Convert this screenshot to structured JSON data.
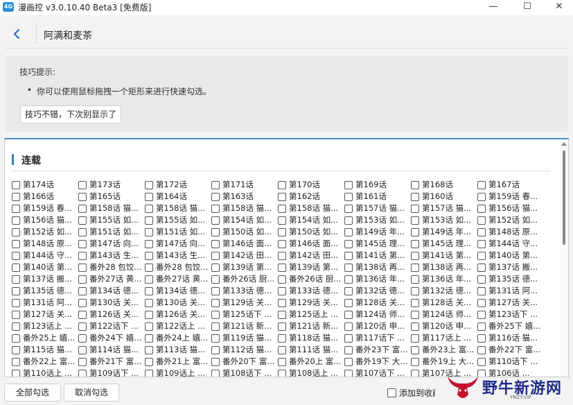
{
  "window": {
    "icon_text": "4G",
    "title": "漫画控 v3.0.10.40 Beta3 [免费版]",
    "minimize_glyph": "—",
    "maximize_glyph": "☐",
    "close_glyph": "✕"
  },
  "header": {
    "title": "阿满和麦茶"
  },
  "tip": {
    "title": "技巧提示:",
    "bullet": "你可以使用鼠标拖拽一个矩形来进行快速勾选。",
    "dismiss_button": "技巧不错，下次别显示了"
  },
  "section": {
    "title": "连载"
  },
  "chapters": [
    "第174话",
    "第173话",
    "第172话",
    "第171话",
    "第170话",
    "第169话",
    "第168话",
    "第167话",
    "第166话",
    "第165话",
    "第164话",
    "第163话",
    "第162话",
    "第161话",
    "第160话",
    "第159话 春...",
    "第159话 春...",
    "第158话 猫...",
    "第158话 猫...",
    "第158话 猫...",
    "第158话 猫...",
    "第157话 猫...",
    "第157话 猫...",
    "第156话 猫...",
    "第156话 猫...",
    "第155话 如...",
    "第155话 如...",
    "第154话 如...",
    "第154话 如...",
    "第153话 如...",
    "第153话 如...",
    "第152话 如...",
    "第152话 如...",
    "第151话 如...",
    "第151话 如...",
    "第150话 如...",
    "第150话 如...",
    "第149话 年...",
    "第149话 年...",
    "第148话 原...",
    "第148话 原...",
    "第147话 向...",
    "第147话 向...",
    "第146话 面...",
    "第146话 面...",
    "第145话 理...",
    "第145话 理...",
    "第144话 守...",
    "第144话 守...",
    "第143话 生...",
    "第143话 生...",
    "第142话 田...",
    "第142话 田...",
    "第141话 第...",
    "第141话 第...",
    "第140话 第...",
    "第140话 第...",
    "番外28 包饺...",
    "番外28 包饺...",
    "第139话 第...",
    "第139话 第...",
    "第138话 再...",
    "第138话 再...",
    "第137话 搬...",
    "第137话 搬...",
    "番外27话 黄...",
    "番外27话 黄...",
    "番外26话 厨...",
    "番外26话 厨...",
    "第136话 年...",
    "第136话 年...",
    "第135话 德...",
    "第135话 德...",
    "第134话 德...",
    "第134话 德...",
    "第133话 德...",
    "第133话 德...",
    "第132话 德...",
    "第132话 德...",
    "第131话 阿...",
    "第131话 阿...",
    "第130话 关...",
    "第130话 关...",
    "第129话 关...",
    "第129话 关...",
    "第128话 关...",
    "第128话 关...",
    "第127话 关...",
    "第127话 关...",
    "第126话 关...",
    "第126话 关...",
    "第125话下 ...",
    "第125话上 ...",
    "第124话 师...",
    "第124话 师...",
    "第123话下 ...",
    "第123话上 ...",
    "第122话下 ...",
    "第122话上 ...",
    "第121话 新...",
    "第121话 新...",
    "第120话 申...",
    "第120话 申...",
    "番外25下 嬉...",
    "番外25上 嬉...",
    "番外24下 嬉...",
    "番外24上 嬉...",
    "第119话 猫...",
    "第118话 猫...",
    "第117话下 ...",
    "第117话上 ...",
    "第116话 猫...",
    "第115话 猫...",
    "第114话 猫...",
    "第113话 猫...",
    "第112话 猫...",
    "第111话 猫...",
    "番外23下 富...",
    "番外23上 富...",
    "番外22下 富...",
    "番外22上 富...",
    "番外21下 富...",
    "番外21上 富...",
    "番外20下 富...",
    "番外20上 富...",
    "番外19下 大...",
    "番外19上 大...",
    "第110话下 ...",
    "第110话上 ...",
    "第109话下 ...",
    "第109话上 ...",
    "第108话下 ...",
    "第108话上 ...",
    "第107话下 ...",
    "第107话上 ...",
    "第106话 ..."
  ],
  "footer": {
    "select_all": "全部勾选",
    "deselect": "取消勾选",
    "add_favorite": "添加到收藏"
  },
  "watermark": {
    "text": "野牛新游网",
    "sub": "YNZY.VIP"
  },
  "colors": {
    "accent": "#3b7fc4",
    "app_icon": "#2b8fd6",
    "watermark": "#1f2b8a"
  }
}
